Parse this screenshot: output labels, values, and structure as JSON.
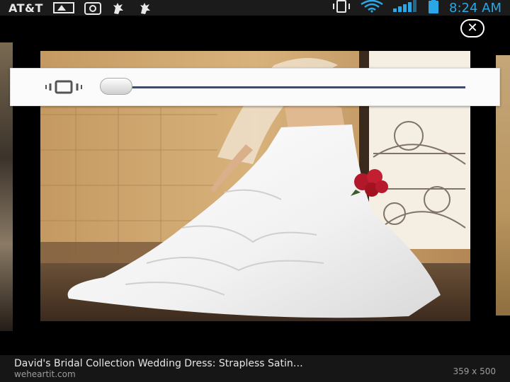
{
  "status_bar": {
    "carrier": "AT&T",
    "time": "8:24 AM",
    "accent_color": "#2aa7e6",
    "icons": [
      "gallery-icon",
      "at-icon",
      "hand-icon",
      "hand-icon",
      "vibrate-icon",
      "wifi-icon",
      "signal-icon",
      "battery-icon"
    ]
  },
  "viewer": {
    "close_icon": "close-icon"
  },
  "volume_overlay": {
    "mode_icon": "vibrate-icon",
    "level": 0
  },
  "caption": {
    "title": "David's Bridal Collection Wedding Dress: Strapless Satin…",
    "source": "weheartit.com",
    "dimensions": "359 x 500"
  }
}
